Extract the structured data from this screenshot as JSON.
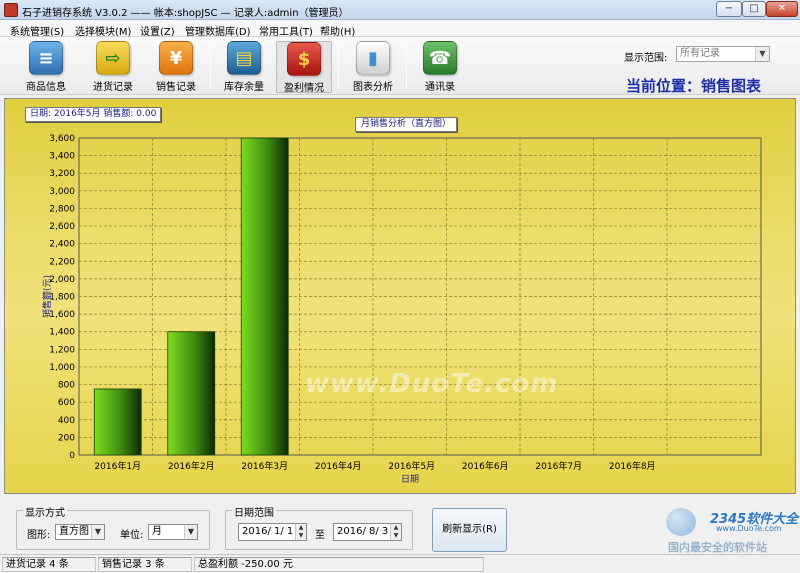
{
  "window": {
    "title": "石子进销存系统 V3.0.2  ——  帐本:shopJSC — 记录人:admin（管理员）",
    "min": "−",
    "max": "□",
    "close": "✕"
  },
  "menu": [
    "系统管理(S)",
    "选择模块(M)",
    "设置(Z)",
    "管理数据库(D)",
    "常用工具(T)",
    "帮助(H)"
  ],
  "toolbar": {
    "items": [
      {
        "label": "商品信息",
        "icon": "document-icon",
        "color": "#3f86c8",
        "glyph": "≡"
      },
      {
        "label": "进货记录",
        "icon": "stock-in-icon",
        "color": "#f0c419",
        "glyph": "⇨"
      },
      {
        "label": "销售记录",
        "icon": "sales-icon",
        "color": "#f08a1c",
        "glyph": "¥"
      },
      {
        "label": "库存余量",
        "icon": "inventory-icon",
        "color": "#3d86b9",
        "glyph": "▤"
      },
      {
        "label": "盈利情况",
        "icon": "profit-icon",
        "color": "#c9221f",
        "glyph": "$"
      },
      {
        "label": "图表分析",
        "icon": "chart-icon",
        "color": "#d9d9d9",
        "glyph": "▮"
      },
      {
        "label": "通讯录",
        "icon": "phone-icon",
        "color": "#3e9a3e",
        "glyph": "☎"
      }
    ],
    "range_label": "显示范围:",
    "range_value": "所有记录",
    "location": "当前位置：销售图表"
  },
  "chart_badges": {
    "date_info": "日期: 2016年5月  销售额: 0.00",
    "title_button": "月销售分析（直方图）"
  },
  "chart_data": {
    "type": "bar",
    "title": "月销售分析（直方图）",
    "categories": [
      "2016年1月",
      "2016年2月",
      "2016年3月",
      "2016年4月",
      "2016年5月",
      "2016年6月",
      "2016年7月",
      "2016年8月"
    ],
    "values": [
      750,
      1400,
      3600,
      0,
      0,
      0,
      0,
      0
    ],
    "xlabel": "日期",
    "ylabel": "销售额(元)",
    "ylim": [
      0,
      3600
    ],
    "yticks": [
      "0",
      "200",
      "400",
      "600",
      "800",
      "1,000",
      "1,200",
      "1,400",
      "1,600",
      "1,800",
      "2,000",
      "2,200",
      "2,400",
      "2,600",
      "2,800",
      "3,000",
      "3,200",
      "3,400",
      "3,600"
    ],
    "grid": true,
    "bar_color": "#7fdc1e"
  },
  "watermark": "www.DuoTe.com",
  "display_mode": {
    "legend": "显示方式",
    "shape_label": "图形:",
    "shape_value": "直方图",
    "unit_label": "单位:",
    "unit_value": "月"
  },
  "date_range": {
    "legend": "日期范围",
    "from": "2016/ 1/ 1",
    "to_label": "至",
    "to": "2016/ 8/ 3"
  },
  "refresh_button": "刷新显示(R)",
  "brand": {
    "name": "2345软件大全",
    "url": "www.DuoTe.com",
    "slogan": "国内最安全的软件站"
  },
  "status": [
    "进货记录 4 条",
    "销售记录 3 条",
    "总盈利额 -250.00 元"
  ]
}
